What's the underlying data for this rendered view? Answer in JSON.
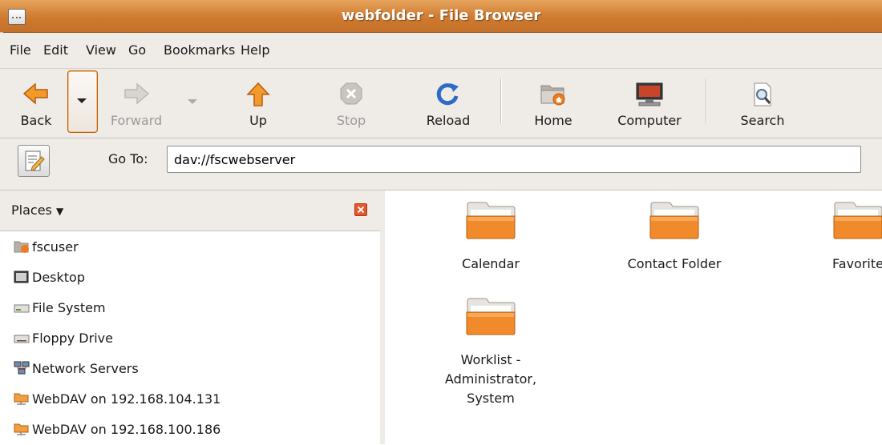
{
  "window": {
    "title": "webfolder - File Browser"
  },
  "menubar": {
    "items": [
      {
        "label": "File"
      },
      {
        "label": "Edit"
      },
      {
        "label": "View"
      },
      {
        "label": "Go"
      },
      {
        "label": "Bookmarks"
      },
      {
        "label": "Help"
      }
    ]
  },
  "toolbar": {
    "back": {
      "label": "Back",
      "icon": "back-arrow-icon"
    },
    "forward": {
      "label": "Forward",
      "icon": "forward-arrow-icon",
      "enabled": false
    },
    "up": {
      "label": "Up",
      "icon": "up-arrow-icon"
    },
    "stop": {
      "label": "Stop",
      "icon": "stop-icon",
      "enabled": false
    },
    "reload": {
      "label": "Reload",
      "icon": "reload-icon"
    },
    "home": {
      "label": "Home",
      "icon": "home-folder-icon"
    },
    "computer": {
      "label": "Computer",
      "icon": "computer-icon"
    },
    "search": {
      "label": "Search",
      "icon": "search-icon"
    }
  },
  "location": {
    "label": "Go To:",
    "value": "dav://fscwebserver"
  },
  "sidebar": {
    "title": "Places",
    "items": [
      {
        "label": "fscuser",
        "icon": "home-folder-icon"
      },
      {
        "label": "Desktop",
        "icon": "desktop-icon"
      },
      {
        "label": "File System",
        "icon": "drive-icon"
      },
      {
        "label": "Floppy Drive",
        "icon": "floppy-icon"
      },
      {
        "label": "Network Servers",
        "icon": "network-icon"
      },
      {
        "label": "WebDAV on 192.168.104.131",
        "icon": "network-folder-icon"
      },
      {
        "label": "WebDAV on 192.168.100.186",
        "icon": "network-folder-icon"
      }
    ]
  },
  "files": [
    {
      "name": "Calendar"
    },
    {
      "name": "Contact Folder"
    },
    {
      "name": "Favorite"
    },
    {
      "name_lines": [
        "Worklist -",
        "Administrator,",
        "System"
      ]
    }
  ],
  "colors": {
    "titlebar": "#cf7a2f",
    "chrome": "#efebe7",
    "folder": "#f08a2b"
  }
}
